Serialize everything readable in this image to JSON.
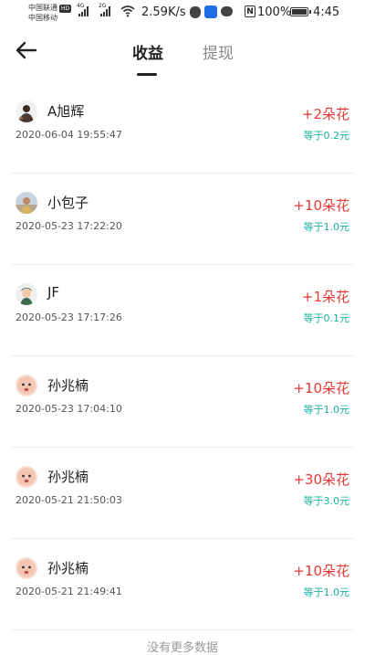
{
  "status_bar": {
    "carrier1": "中国联通",
    "carrier1_badge": "HD",
    "carrier2": "中国移动",
    "net1": "4G",
    "net2": "2G",
    "speed": "2.59K/s",
    "battery": "100%",
    "time": "4:45",
    "icons": [
      "wifi-icon",
      "shield-icon",
      "app-icon",
      "chat-icon",
      "nfc-icon",
      "battery-icon"
    ]
  },
  "header": {
    "back_icon": "arrow-left-icon",
    "tabs": [
      {
        "label": "收益",
        "active": true
      },
      {
        "label": "提现",
        "active": false
      }
    ]
  },
  "records": [
    {
      "name": "A旭辉",
      "time": "2020-06-04 19:55:47",
      "amount": "+2朵花",
      "equiv": "等于0.2元",
      "avatar": "avatar-photo"
    },
    {
      "name": "小包子",
      "time": "2020-05-23 17:22:20",
      "amount": "+10朵花",
      "equiv": "等于1.0元",
      "avatar": "avatar-photo"
    },
    {
      "name": "JF",
      "time": "2020-05-23 17:17:26",
      "amount": "+1朵花",
      "equiv": "等于0.1元",
      "avatar": "avatar-photo"
    },
    {
      "name": "孙兆楠",
      "time": "2020-05-23 17:04:10",
      "amount": "+10朵花",
      "equiv": "等于1.0元",
      "avatar": "avatar-baby"
    },
    {
      "name": "孙兆楠",
      "time": "2020-05-21 21:50:03",
      "amount": "+30朵花",
      "equiv": "等于3.0元",
      "avatar": "avatar-baby"
    },
    {
      "name": "孙兆楠",
      "time": "2020-05-21 21:49:41",
      "amount": "+10朵花",
      "equiv": "等于1.0元",
      "avatar": "avatar-baby"
    }
  ],
  "footer": {
    "text": "没有更多数据"
  },
  "colors": {
    "amount": "#e53935",
    "equiv": "#1bb3a0",
    "tab_active": "#222222",
    "tab_inactive": "#888888"
  }
}
